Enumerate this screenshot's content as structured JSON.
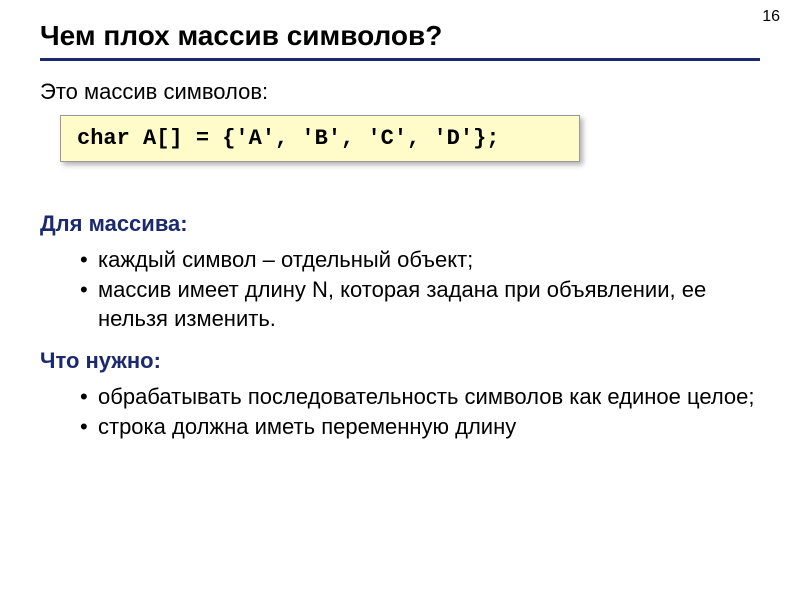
{
  "page_number": "16",
  "title": "Чем плох массив символов?",
  "subtitle": "Это массив символов:",
  "code": "char A[] = {'A', 'B', 'C', 'D'};",
  "section1": {
    "header": "Для массива:",
    "items": [
      "каждый символ – отдельный объект;",
      "массив имеет длину N, которая задана при объявлении, ее нельзя изменить."
    ]
  },
  "section2": {
    "header": "Что нужно:",
    "items": [
      "обрабатывать последовательность символов как единое целое;",
      "строка должна иметь переменную длину"
    ]
  }
}
